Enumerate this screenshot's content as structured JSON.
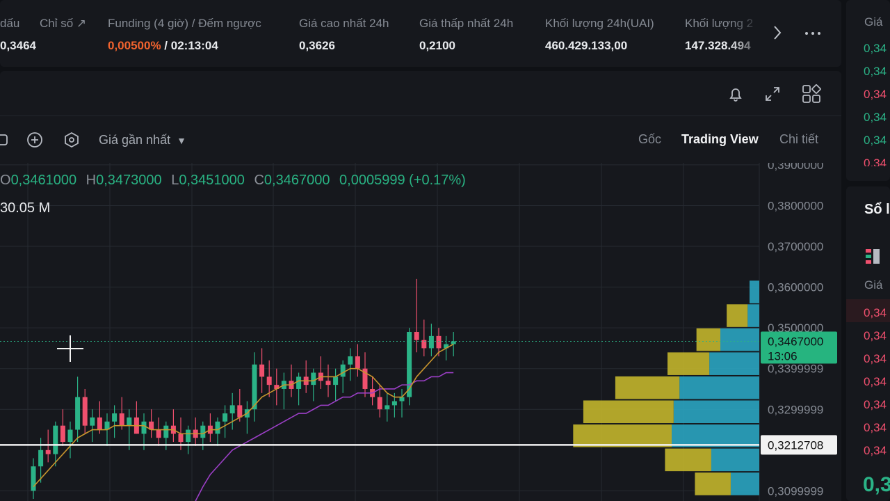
{
  "ticker": {
    "stats": [
      {
        "label": "dấu",
        "value": "0,3464"
      },
      {
        "label": "Chỉ số ↗",
        "value": ""
      },
      {
        "label": "Funding (4 giờ) / Đếm ngược",
        "value_rate": "0,00500%",
        "value_countdown": " / 02:13:04"
      },
      {
        "label": "Giá cao nhất 24h",
        "value": "0,3626"
      },
      {
        "label": "Giá thấp nhất 24h",
        "value": "0,2100"
      },
      {
        "label": "Khối lượng 24h(UAI)",
        "value": "460.429.133,00"
      },
      {
        "label": "Khối lượng 2",
        "value": "147.328.494"
      }
    ],
    "next_icon": "chevron-right-icon",
    "more_icon": "more-icon"
  },
  "chart_toolbar": {
    "icons": [
      "bell-icon",
      "expand-icon",
      "layout-icon"
    ],
    "tool_icons": [
      "screenshot-icon",
      "plus-circle-icon",
      "settings-hex-icon"
    ],
    "price_source": "Giá gần nhất",
    "views": [
      "Gốc",
      "Trading View",
      "Chi tiết"
    ],
    "active_view": "Trading View"
  },
  "ohlc": {
    "o_key": "O",
    "o_val": "0,3461000",
    "h_key": "H",
    "h_val": "0,3473000",
    "l_key": "L",
    "l_val": "0,3451000",
    "c_key": "C",
    "c_val": "0,3467000",
    "change": "0,0005999 (+0.17%)"
  },
  "volume_label": "30.05 M",
  "chart_data": {
    "type": "candlestick",
    "y_ticks": [
      "0,3900000",
      "0,3800000",
      "0,3700000",
      "0,3600000",
      "0,3500000",
      "0,3399999",
      "0,3299999",
      "0,3099999"
    ],
    "ylim": [
      0.3075,
      0.3905
    ],
    "last_price": {
      "value": "0,3467000",
      "countdown": "13:06"
    },
    "horizontal_line": "0,3212708",
    "candles": [
      [
        0.31,
        0.318,
        0.308,
        0.316
      ],
      [
        0.316,
        0.323,
        0.312,
        0.32
      ],
      [
        0.32,
        0.325,
        0.317,
        0.319
      ],
      [
        0.319,
        0.327,
        0.316,
        0.326
      ],
      [
        0.326,
        0.33,
        0.321,
        0.322
      ],
      [
        0.322,
        0.327,
        0.318,
        0.325
      ],
      [
        0.325,
        0.338,
        0.322,
        0.333
      ],
      [
        0.333,
        0.335,
        0.324,
        0.326
      ],
      [
        0.326,
        0.33,
        0.322,
        0.328
      ],
      [
        0.328,
        0.332,
        0.324,
        0.325
      ],
      [
        0.325,
        0.329,
        0.321,
        0.327
      ],
      [
        0.327,
        0.331,
        0.323,
        0.329
      ],
      [
        0.329,
        0.333,
        0.325,
        0.326
      ],
      [
        0.326,
        0.33,
        0.32,
        0.328
      ],
      [
        0.328,
        0.332,
        0.324,
        0.324
      ],
      [
        0.324,
        0.329,
        0.32,
        0.327
      ],
      [
        0.327,
        0.33,
        0.323,
        0.325
      ],
      [
        0.325,
        0.328,
        0.321,
        0.323
      ],
      [
        0.323,
        0.327,
        0.32,
        0.326
      ],
      [
        0.326,
        0.33,
        0.322,
        0.324
      ],
      [
        0.324,
        0.328,
        0.32,
        0.322
      ],
      [
        0.322,
        0.326,
        0.319,
        0.325
      ],
      [
        0.325,
        0.328,
        0.321,
        0.323
      ],
      [
        0.323,
        0.327,
        0.32,
        0.326
      ],
      [
        0.326,
        0.329,
        0.322,
        0.324
      ],
      [
        0.324,
        0.328,
        0.321,
        0.327
      ],
      [
        0.327,
        0.331,
        0.323,
        0.329
      ],
      [
        0.329,
        0.334,
        0.325,
        0.331
      ],
      [
        0.331,
        0.335,
        0.327,
        0.328
      ],
      [
        0.328,
        0.332,
        0.324,
        0.33
      ],
      [
        0.33,
        0.344,
        0.327,
        0.341
      ],
      [
        0.341,
        0.345,
        0.334,
        0.338
      ],
      [
        0.338,
        0.342,
        0.333,
        0.336
      ],
      [
        0.336,
        0.34,
        0.331,
        0.335
      ],
      [
        0.335,
        0.339,
        0.33,
        0.337
      ],
      [
        0.337,
        0.341,
        0.333,
        0.335
      ],
      [
        0.335,
        0.339,
        0.331,
        0.338
      ],
      [
        0.338,
        0.342,
        0.334,
        0.336
      ],
      [
        0.336,
        0.34,
        0.332,
        0.339
      ],
      [
        0.339,
        0.343,
        0.335,
        0.337
      ],
      [
        0.337,
        0.341,
        0.333,
        0.336
      ],
      [
        0.336,
        0.34,
        0.332,
        0.338
      ],
      [
        0.338,
        0.342,
        0.334,
        0.341
      ],
      [
        0.341,
        0.345,
        0.337,
        0.343
      ],
      [
        0.343,
        0.346,
        0.338,
        0.34
      ],
      [
        0.34,
        0.344,
        0.333,
        0.335
      ],
      [
        0.335,
        0.338,
        0.331,
        0.333
      ],
      [
        0.333,
        0.336,
        0.328,
        0.33
      ],
      [
        0.33,
        0.334,
        0.327,
        0.331
      ],
      [
        0.331,
        0.334,
        0.328,
        0.332
      ],
      [
        0.332,
        0.335,
        0.328,
        0.333
      ],
      [
        0.333,
        0.35,
        0.331,
        0.349
      ],
      [
        0.349,
        0.362,
        0.344,
        0.347
      ],
      [
        0.347,
        0.352,
        0.343,
        0.345
      ],
      [
        0.345,
        0.351,
        0.343,
        0.348
      ],
      [
        0.348,
        0.35,
        0.343,
        0.345
      ],
      [
        0.345,
        0.348,
        0.342,
        0.346
      ],
      [
        0.346,
        0.349,
        0.343,
        0.3467
      ]
    ],
    "ma_fast": [
      0.311,
      0.313,
      0.315,
      0.317,
      0.319,
      0.321,
      0.323,
      0.324,
      0.325,
      0.325,
      0.325,
      0.326,
      0.326,
      0.326,
      0.326,
      0.326,
      0.325,
      0.325,
      0.325,
      0.325,
      0.324,
      0.324,
      0.324,
      0.324,
      0.325,
      0.325,
      0.326,
      0.327,
      0.328,
      0.329,
      0.331,
      0.333,
      0.334,
      0.335,
      0.336,
      0.336,
      0.337,
      0.337,
      0.337,
      0.338,
      0.338,
      0.338,
      0.339,
      0.34,
      0.34,
      0.339,
      0.338,
      0.336,
      0.334,
      0.333,
      0.333,
      0.335,
      0.338,
      0.34,
      0.342,
      0.344,
      0.345,
      0.346
    ],
    "ma_slow": [
      null,
      null,
      null,
      null,
      null,
      null,
      null,
      null,
      null,
      null,
      null,
      null,
      null,
      null,
      null,
      null,
      null,
      null,
      null,
      null,
      null,
      null,
      0.3075,
      0.311,
      0.314,
      0.316,
      0.318,
      0.32,
      0.321,
      0.322,
      0.323,
      0.324,
      0.325,
      0.326,
      0.327,
      0.328,
      0.329,
      0.329,
      0.33,
      0.331,
      0.331,
      0.332,
      0.333,
      0.333,
      0.334,
      0.334,
      0.334,
      0.335,
      0.335,
      0.335,
      0.336,
      0.336,
      0.337,
      0.337,
      0.338,
      0.338,
      0.339,
      0.339
    ],
    "volume_profile": [
      {
        "price": 0.3588,
        "up": 0.0,
        "down": 0.15
      },
      {
        "price": 0.353,
        "up": 0.28,
        "down": 0.18
      },
      {
        "price": 0.3471,
        "up": 0.32,
        "down": 0.6
      },
      {
        "price": 0.3412,
        "up": 0.56,
        "down": 0.77
      },
      {
        "price": 0.3353,
        "up": 0.86,
        "down": 1.23
      },
      {
        "price": 0.3294,
        "up": 1.21,
        "down": 1.32
      },
      {
        "price": 0.3235,
        "up": 1.32,
        "down": 1.35
      },
      {
        "price": 0.3176,
        "up": 0.62,
        "down": 0.74
      },
      {
        "price": 0.3117,
        "up": 0.48,
        "down": 0.44
      }
    ],
    "colors": {
      "up": "#2bb387",
      "down": "#f0506e",
      "ma_fast": "#c8952d",
      "ma_slow": "#9b3fc6",
      "vp_up": "#c2b52c",
      "vp_down": "#2aa2bd"
    }
  },
  "side_top": {
    "header": "Giá",
    "rows": [
      {
        "text": "0,34",
        "color": "#2bb387"
      },
      {
        "text": "0,34",
        "color": "#2bb387"
      },
      {
        "text": "0,34",
        "color": "#f0506e"
      },
      {
        "text": "0,34",
        "color": "#2bb387"
      },
      {
        "text": "0,34",
        "color": "#2bb387"
      },
      {
        "text": "0,34",
        "color": "#f0506e"
      }
    ]
  },
  "side_bottom": {
    "title": "Sổ l",
    "header": "Giá",
    "rows": [
      {
        "text": "0,34",
        "color": "#f0506e"
      },
      {
        "text": "0,34",
        "color": "#f0506e"
      },
      {
        "text": "0,34",
        "color": "#f0506e"
      },
      {
        "text": "0,34",
        "color": "#f0506e"
      },
      {
        "text": "0,34",
        "color": "#f0506e"
      },
      {
        "text": "0,34",
        "color": "#f0506e"
      },
      {
        "text": "0,34",
        "color": "#f0506e"
      }
    ],
    "big_price": "0,3"
  }
}
